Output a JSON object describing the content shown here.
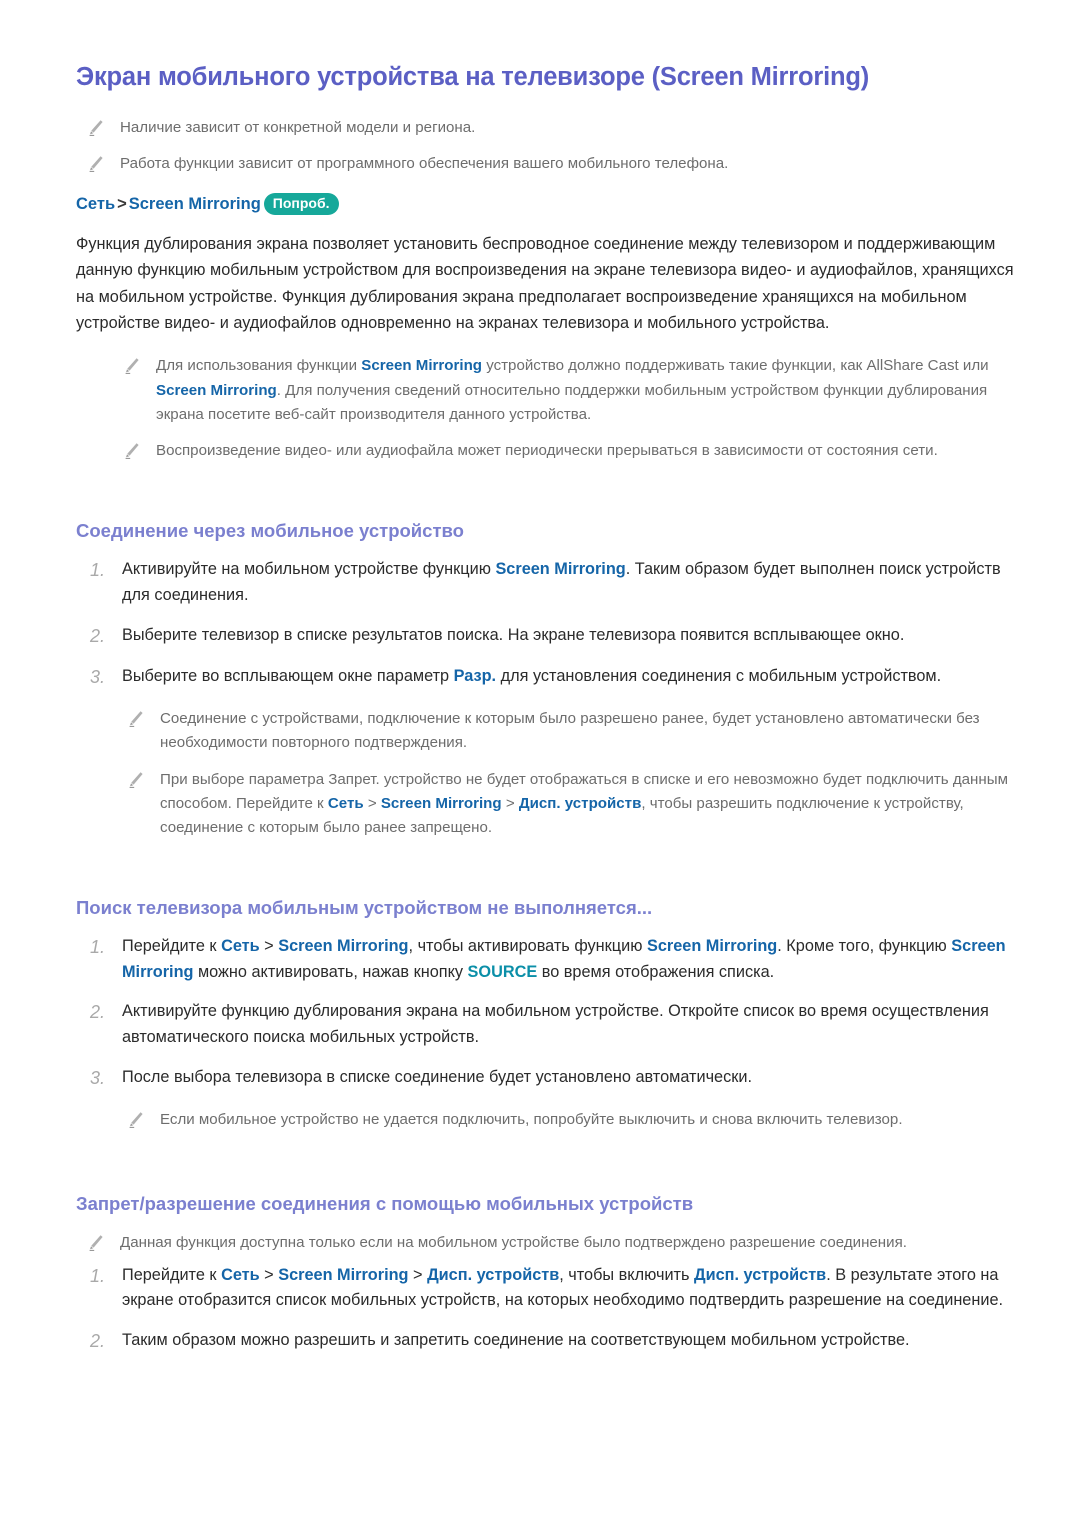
{
  "document": {
    "title": "Экран мобильного устройства на телевизоре (Screen Mirroring)",
    "colors": {
      "title": "#5b5fc4",
      "section_heading": "#7b80cf",
      "keyword_blue": "#1565a8",
      "keyword_teal": "#0b8fa8",
      "badge_bg": "#16a89a",
      "note_text": "#6d6d6d",
      "body_text": "#2b2b2b",
      "number_marker": "#a9a9a9"
    }
  },
  "intro_notes": [
    {
      "icon": "pencil-icon",
      "text": "Наличие зависит от конкретной модели и региона."
    },
    {
      "icon": "pencil-icon",
      "text": "Работа функции зависит от программного обеспечения вашего мобильного телефона."
    }
  ],
  "breadcrumb": {
    "part1": "Сеть",
    "separator": ">",
    "part2": "Screen Mirroring",
    "badge": "Попроб."
  },
  "main_paragraph": {
    "text": "Функция дублирования экрана позволяет установить беспроводное соединение между телевизором и поддерживающим данную функцию мобильным устройством для воспроизведения на экране телевизора видео- и аудиофайлов, хранящихся на мобильном устройстве. Функция дублирования экрана предполагает воспроизведение хранящихся на мобильном устройстве видео- и аудиофайлов одновременно на экранах телевизора и мобильного устройства."
  },
  "main_notes": [
    {
      "icon": "pencil-icon",
      "seg": [
        {
          "t": "Для использования функции ",
          "s": "plain"
        },
        {
          "t": "Screen Mirroring",
          "s": "key"
        },
        {
          "t": " устройство должно поддерживать такие функции, как AllShare Cast или ",
          "s": "plain"
        },
        {
          "t": "Screen Mirroring",
          "s": "key"
        },
        {
          "t": ". Для получения сведений относительно поддержки мобильным устройством функции дублирования экрана посетите веб-сайт производителя данного устройства.",
          "s": "plain"
        }
      ]
    },
    {
      "icon": "pencil-icon",
      "seg": [
        {
          "t": "Воспроизведение видео- или аудиофайла может периодически прерываться в зависимости от состояния сети.",
          "s": "plain"
        }
      ]
    }
  ],
  "section_connect": {
    "heading": "Соединение через мобильное устройство",
    "steps": [
      {
        "num": "1.",
        "seg": [
          {
            "t": "Активируйте на мобильном устройстве функцию ",
            "s": "plain"
          },
          {
            "t": "Screen Mirroring",
            "s": "key"
          },
          {
            "t": ". Таким образом будет выполнен поиск устройств для соединения.",
            "s": "plain"
          }
        ]
      },
      {
        "num": "2.",
        "seg": [
          {
            "t": "Выберите телевизор в списке результатов поиска. На экране телевизора появится всплывающее окно.",
            "s": "plain"
          }
        ]
      },
      {
        "num": "3.",
        "seg": [
          {
            "t": "Выберите во всплывающем окне параметр ",
            "s": "plain"
          },
          {
            "t": "Разр.",
            "s": "key"
          },
          {
            "t": " для установления соединения с мобильным устройством.",
            "s": "plain"
          }
        ]
      }
    ],
    "notes": [
      {
        "icon": "pencil-icon",
        "seg": [
          {
            "t": "Соединение с устройствами, подключение к которым было разрешено ранее, будет установлено автоматически без необходимости повторного подтверждения.",
            "s": "plain"
          }
        ]
      },
      {
        "icon": "pencil-icon",
        "seg": [
          {
            "t": "При выборе параметра Запрет. устройство не будет отображаться в списке и его невозможно будет подключить данным способом. Перейдите к ",
            "s": "plain"
          },
          {
            "t": "Сеть",
            "s": "key"
          },
          {
            "t": " > ",
            "s": "plain"
          },
          {
            "t": "Screen Mirroring",
            "s": "key"
          },
          {
            "t": " > ",
            "s": "plain"
          },
          {
            "t": "Дисп. устройств",
            "s": "key"
          },
          {
            "t": ", чтобы разрешить подключение к устройству, соединение с которым было ранее запрещено.",
            "s": "plain"
          }
        ]
      }
    ]
  },
  "section_search": {
    "heading": "Поиск телевизора мобильным устройством не выполняется...",
    "steps": [
      {
        "num": "1.",
        "seg": [
          {
            "t": "Перейдите к ",
            "s": "plain"
          },
          {
            "t": "Сеть",
            "s": "key"
          },
          {
            "t": " > ",
            "s": "plain"
          },
          {
            "t": "Screen Mirroring",
            "s": "key"
          },
          {
            "t": ", чтобы активировать функцию ",
            "s": "plain"
          },
          {
            "t": "Screen Mirroring",
            "s": "key"
          },
          {
            "t": ". Кроме того, функцию ",
            "s": "plain"
          },
          {
            "t": "Screen Mirroring",
            "s": "key"
          },
          {
            "t": " можно активировать, нажав кнопку ",
            "s": "plain"
          },
          {
            "t": "SOURCE",
            "s": "teal"
          },
          {
            "t": " во время отображения списка.",
            "s": "plain"
          }
        ]
      },
      {
        "num": "2.",
        "seg": [
          {
            "t": "Активируйте функцию дублирования экрана на мобильном устройстве. Откройте список во время осуществления автоматического поиска мобильных устройств.",
            "s": "plain"
          }
        ]
      },
      {
        "num": "3.",
        "seg": [
          {
            "t": "После выбора телевизора в списке соединение будет установлено автоматически.",
            "s": "plain"
          }
        ]
      }
    ],
    "notes": [
      {
        "icon": "pencil-icon",
        "seg": [
          {
            "t": "Если мобильное устройство не удается подключить, попробуйте выключить и снова включить телевизор.",
            "s": "plain"
          }
        ]
      }
    ]
  },
  "section_permission": {
    "heading": "Запрет/разрешение соединения с помощью мобильных устройств",
    "notes": [
      {
        "icon": "pencil-icon",
        "seg": [
          {
            "t": "Данная функция доступна только если на мобильном устройстве было подтверждено разрешение соединения.",
            "s": "plain"
          }
        ]
      }
    ],
    "steps": [
      {
        "num": "1.",
        "seg": [
          {
            "t": "Перейдите к ",
            "s": "plain"
          },
          {
            "t": "Сеть",
            "s": "key"
          },
          {
            "t": " > ",
            "s": "plain"
          },
          {
            "t": "Screen Mirroring",
            "s": "key"
          },
          {
            "t": " > ",
            "s": "plain"
          },
          {
            "t": "Дисп. устройств",
            "s": "key"
          },
          {
            "t": ", чтобы включить ",
            "s": "plain"
          },
          {
            "t": "Дисп. устройств",
            "s": "key"
          },
          {
            "t": ". В результате этого на экране отобразится список мобильных устройств, на которых необходимо подтвердить разрешение на соединение.",
            "s": "plain"
          }
        ]
      },
      {
        "num": "2.",
        "seg": [
          {
            "t": "Таким образом можно разрешить и запретить соединение на соответствующем мобильном устройстве.",
            "s": "plain"
          }
        ]
      }
    ]
  }
}
